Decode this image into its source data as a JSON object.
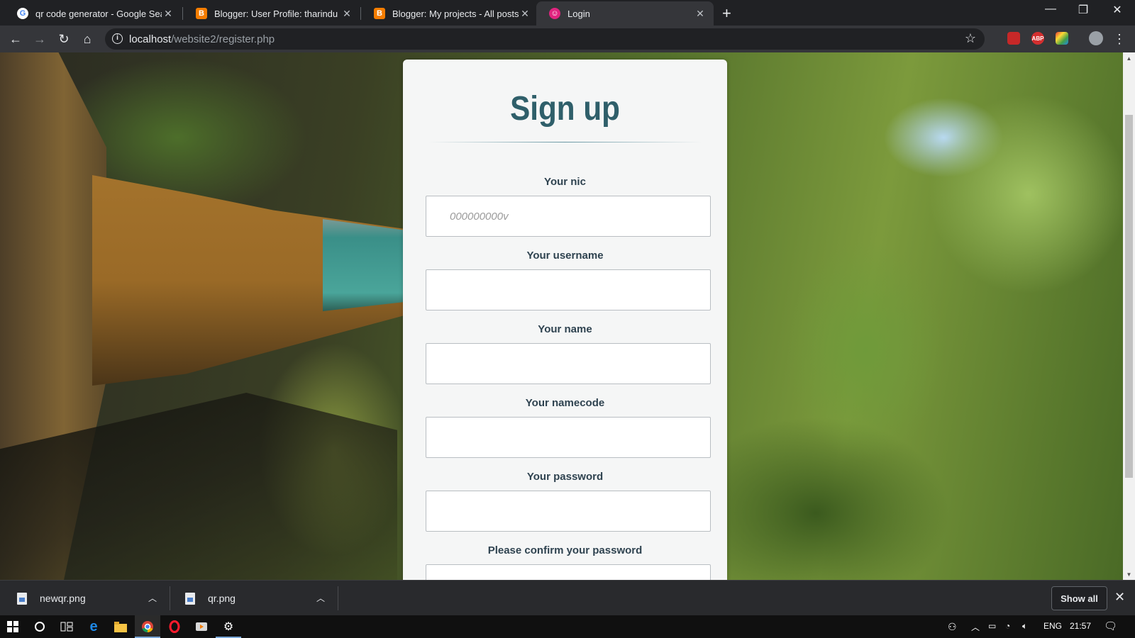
{
  "browser": {
    "tabs": [
      {
        "title": "qr code generator - Google Search",
        "favicon": "google-icon",
        "active": false
      },
      {
        "title": "Blogger: User Profile: tharindu",
        "favicon": "blogger-icon",
        "active": false
      },
      {
        "title": "Blogger: My projects - All posts",
        "favicon": "blogger-icon",
        "active": false
      },
      {
        "title": "Login",
        "favicon": "login-icon",
        "active": true
      }
    ],
    "url_host": "localhost",
    "url_path": "/website2/register.php",
    "extensions": [
      "ABP"
    ]
  },
  "form": {
    "title": "Sign up",
    "fields": [
      {
        "label": "Your nic",
        "placeholder": "000000000v",
        "value": ""
      },
      {
        "label": "Your username",
        "placeholder": "",
        "value": ""
      },
      {
        "label": "Your name",
        "placeholder": "",
        "value": ""
      },
      {
        "label": "Your namecode",
        "placeholder": "",
        "value": ""
      },
      {
        "label": "Your password",
        "placeholder": "",
        "value": ""
      },
      {
        "label": "Please confirm your password",
        "placeholder": "",
        "value": ""
      }
    ],
    "accent_color": "#2f5f6a"
  },
  "downloads": {
    "items": [
      {
        "filename": "newqr.png"
      },
      {
        "filename": "qr.png"
      }
    ],
    "show_all_label": "Show all"
  },
  "taskbar": {
    "language": "ENG",
    "time": "21:57"
  }
}
